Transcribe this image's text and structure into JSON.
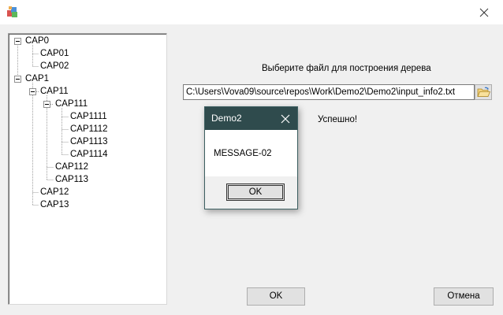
{
  "tree": [
    {
      "label": "CAP0"
    },
    {
      "label": "CAP01"
    },
    {
      "label": "CAP02"
    },
    {
      "label": "CAP1"
    },
    {
      "label": "CAP11"
    },
    {
      "label": "CAP111"
    },
    {
      "label": "CAP1111"
    },
    {
      "label": "CAP1112"
    },
    {
      "label": "CAP1113"
    },
    {
      "label": "CAP1114"
    },
    {
      "label": "CAP112"
    },
    {
      "label": "CAP113"
    },
    {
      "label": "CAP12"
    },
    {
      "label": "CAP13"
    }
  ],
  "main": {
    "prompt": "Выберите файл для построения дерева",
    "file_path": "C:\\Users\\Vova09\\source\\repos\\Work\\Demo2\\Demo2\\input_info2.txt",
    "status": "Успешно!"
  },
  "dialog": {
    "title": "Demo2",
    "message": "MESSAGE-02",
    "ok_label": "OK"
  },
  "buttons": {
    "ok_label": "OK",
    "cancel_label": "Отмена"
  },
  "colors": {
    "dialog_title_bg": "#2f4b4d",
    "window_bg": "#f0f0f0"
  }
}
